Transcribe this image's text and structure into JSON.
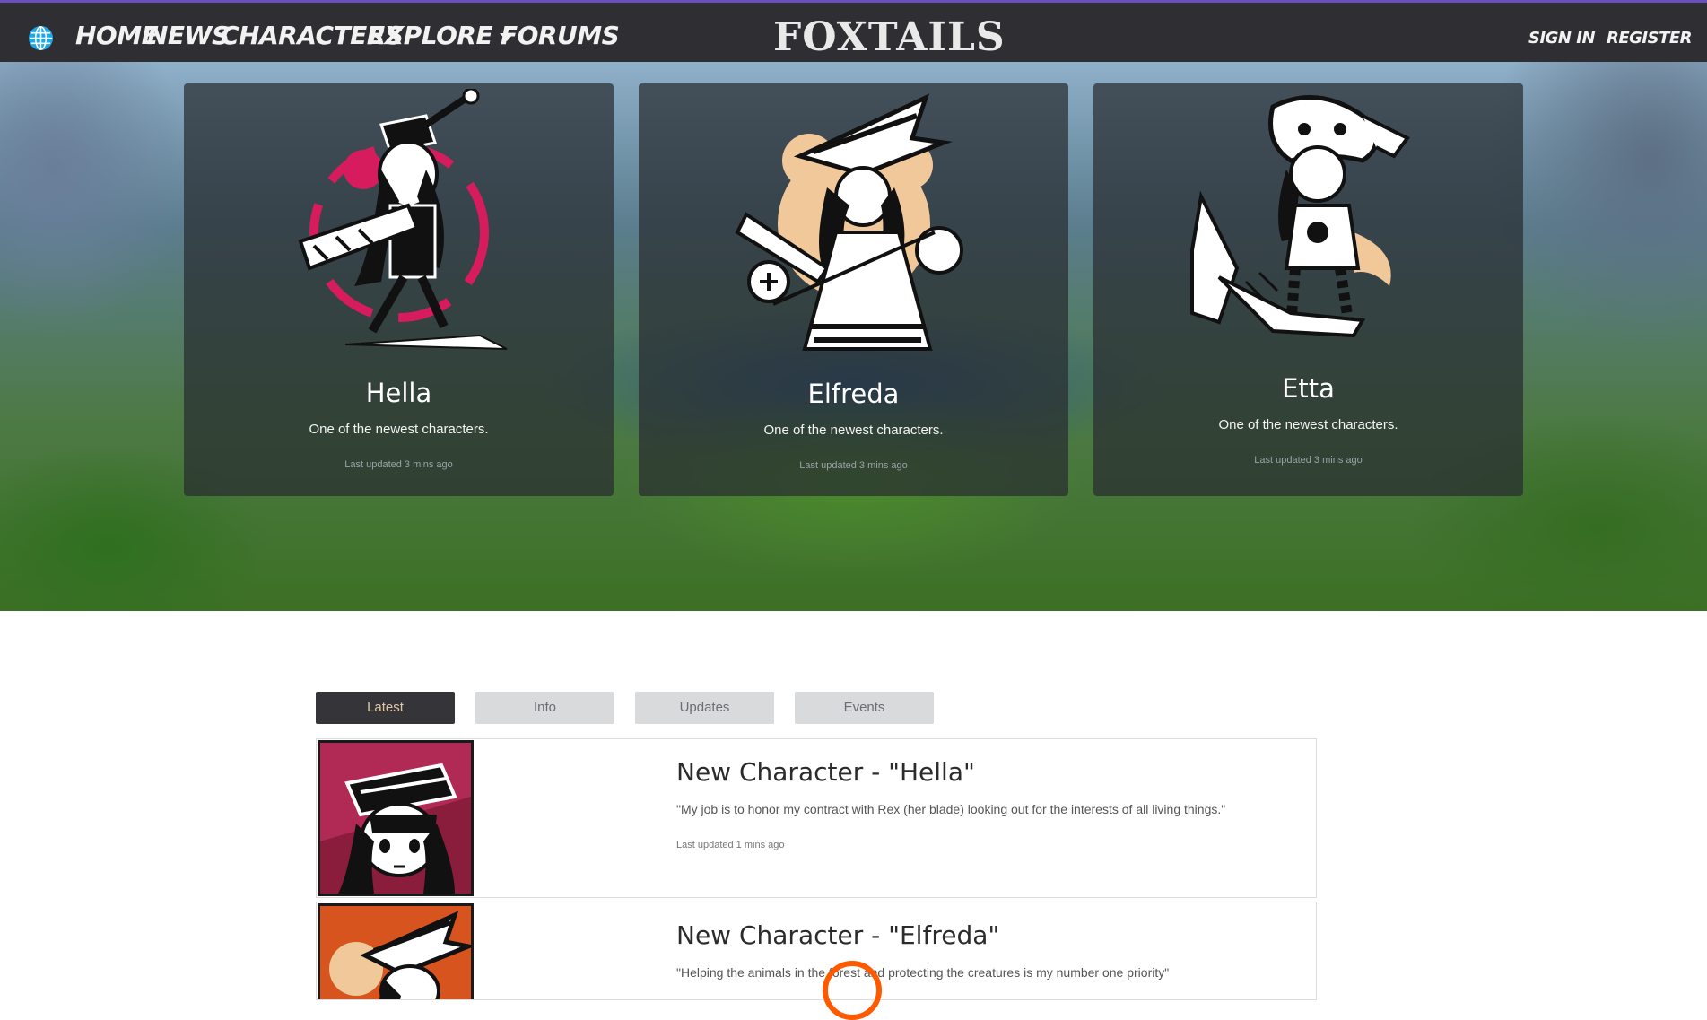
{
  "nav": {
    "home": "HOME",
    "news": "NEWS",
    "characters": "CHARACTERS",
    "explore": "EXPLORE",
    "forums": "FORUMS",
    "brand": "FOXTAILS",
    "sign_in": "SIGN IN",
    "register": "REGISTER"
  },
  "featured": [
    {
      "name": "Hella",
      "desc": "One of the newest characters.",
      "updated": "Last updated 3 mins ago"
    },
    {
      "name": "Elfreda",
      "desc": "One of the newest characters.",
      "updated": "Last updated 3 mins ago"
    },
    {
      "name": "Etta",
      "desc": "One of the newest characters.",
      "updated": "Last updated 3 mins ago"
    }
  ],
  "tabs": [
    "Latest",
    "Info",
    "Updates",
    "Events"
  ],
  "news": [
    {
      "title": "New Character - \"Hella\"",
      "quote": "\"My job is to honor my contract with Rex (her blade) looking out for the interests of all living things.\"",
      "updated": "Last updated 1 mins ago"
    },
    {
      "title": "New Character - \"Elfreda\"",
      "quote": "\"Helping the animals in the forest and protecting the creatures is my number one priority\""
    }
  ],
  "colors": {
    "nav_bg": "#2f2f33",
    "accent_bar": "#6b4fbf",
    "active_tab": "#343439",
    "active_tab_text": "#e0c7a6",
    "hella_thumb": "#8a1d3c",
    "elfreda_thumb": "#d8541f",
    "cursor": "#ff5a00"
  }
}
